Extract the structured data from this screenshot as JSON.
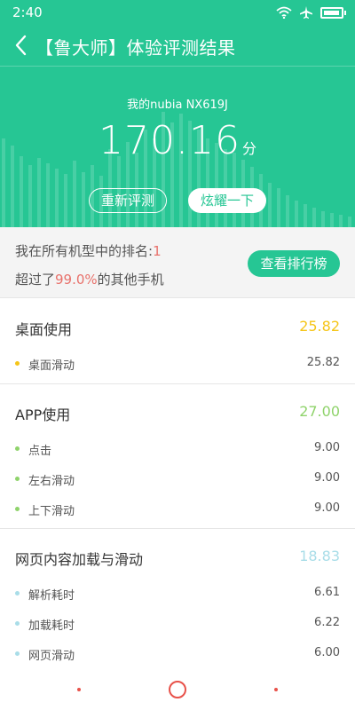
{
  "status_bar": {
    "time": "2:40",
    "icons": [
      "wifi-icon",
      "airplane-icon",
      "battery-icon"
    ]
  },
  "header": {
    "back_icon": "chevron-left-icon",
    "title": "【鲁大师】体验评测结果"
  },
  "result": {
    "device": "我的nubia NX619J",
    "score": "170.16",
    "unit": "分",
    "retest_label": "重新评测",
    "share_label": "炫耀一下"
  },
  "ranking": {
    "rank_prefix": "我在所有机型中的排名:",
    "rank_value": "1",
    "beat_prefix": "超过了",
    "beat_value": "99.0%",
    "beat_suffix": "的其他手机",
    "button_label": "查看排行榜"
  },
  "sections": [
    {
      "title": "桌面使用",
      "total": "25.82",
      "color": "#f5c518",
      "items": [
        {
          "label": "桌面滑动",
          "value": "25.82"
        }
      ]
    },
    {
      "title": "APP使用",
      "total": "27.00",
      "color": "#8fd36b",
      "items": [
        {
          "label": "点击",
          "value": "9.00"
        },
        {
          "label": "左右滑动",
          "value": "9.00"
        },
        {
          "label": "上下滑动",
          "value": "9.00"
        }
      ]
    },
    {
      "title": "网页内容加载与滑动",
      "total": "18.83",
      "color": "#a9dde8",
      "items": [
        {
          "label": "解析耗时",
          "value": "6.61"
        },
        {
          "label": "加载耗时",
          "value": "6.22"
        },
        {
          "label": "网页滑动",
          "value": "6.00"
        }
      ]
    }
  ],
  "colors": {
    "brand": "#26c694",
    "highlight": "#e8716b",
    "nav_accent": "#e8524a"
  },
  "nav_bar": {
    "icons": [
      "back-dot-icon",
      "home-circle-icon",
      "recent-dot-icon"
    ]
  }
}
